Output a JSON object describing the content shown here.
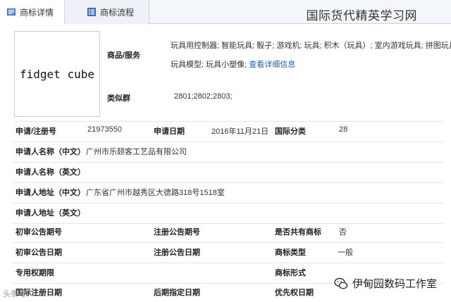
{
  "tabs": [
    {
      "label": "商标详情"
    },
    {
      "label": "商标流程"
    }
  ],
  "site_title": "国际货代精英学习网",
  "logo_text": "fidget cube",
  "goods": {
    "label": "商品/服务",
    "line1": "玩具用控制器; 智能玩具; 骰子; 游戏机; 玩具; 积木（玩具）; 室内游戏玩具; 拼图玩具;",
    "line2": "玩具模型; 玩具小塑像;",
    "more_link": "查看详细信息"
  },
  "similar_group": {
    "label": "类似群",
    "value": "2801;2802;2803;"
  },
  "info": {
    "reg_no_label": "申请/注册号",
    "reg_no": "21973550",
    "apply_date_label": "申请日期",
    "apply_date": "2016年11月21日",
    "intl_class_label": "国际分类",
    "intl_class": "28",
    "applicant_cn_label": "申请人名称（中文）",
    "applicant_cn": "广州市乐颐客工艺品有限公司",
    "applicant_en_label": "申请人名称（英文）",
    "address_cn_label": "申请人地址（中文）",
    "address_cn": "广东省广州市越秀区大德路318号1518室",
    "address_en_label": "申请人地址（英文）",
    "prelim_issue_label": "初审公告期号",
    "reg_issue_label": "注册公告期号",
    "shared_label": "是否共有商标",
    "shared_value": "否",
    "prelim_date_label": "初审公告日期",
    "reg_date_label": "注册公告日期",
    "type_label": "商标类型",
    "type_value": "一般",
    "exclusive_label": "专用权期限",
    "form_label": "商标形式",
    "intl_reg_date_label": "国际注册日期",
    "later_date_label": "后期指定日期",
    "priority_date_label": "优先权日期"
  },
  "watermark": {
    "brand": "伊甸园数码工作室",
    "left": "头条号"
  }
}
